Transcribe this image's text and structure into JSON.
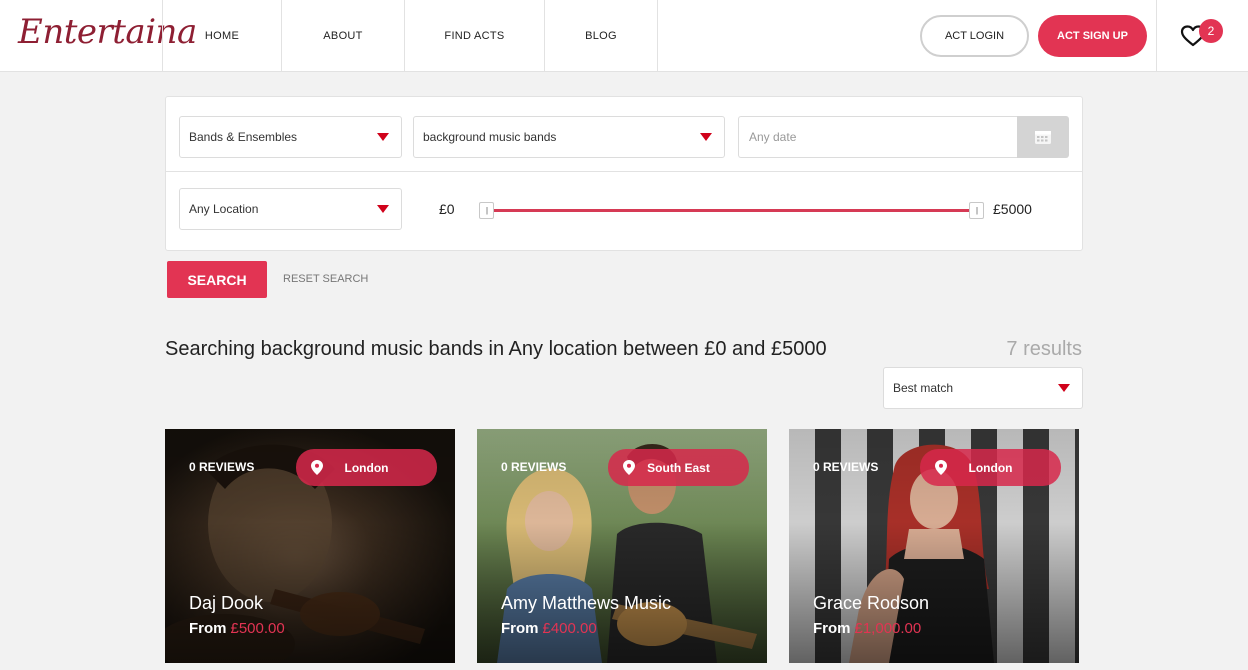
{
  "brand": {
    "logo": "Entertaina"
  },
  "nav": {
    "items": [
      "HOME",
      "ABOUT",
      "FIND ACTS",
      "BLOG"
    ],
    "act_login": "ACT LOGIN",
    "act_signup": "ACT SIGN UP",
    "favourites_count": "2"
  },
  "search": {
    "category": "Bands & Ensembles",
    "subcategory": "background music bands",
    "date_placeholder": "Any date",
    "location": "Any Location",
    "price_min": "£0",
    "price_max": "£5000",
    "search_button": "SEARCH",
    "reset_link": "RESET SEARCH"
  },
  "results": {
    "summary": "Searching background music bands in Any location between £0 and £5000",
    "count": "7 results",
    "sort": "Best match"
  },
  "cards": [
    {
      "reviews": "0 REVIEWS",
      "location": "London",
      "name": "Daj Dook",
      "from": "From",
      "price": "£500.00"
    },
    {
      "reviews": "0 REVIEWS",
      "location": "South East",
      "name": "Amy Matthews Music",
      "from": "From",
      "price": "£400.00"
    },
    {
      "reviews": "0 REVIEWS",
      "location": "London",
      "name": "Grace Rodson",
      "from": "From",
      "price": "£1,000.00"
    }
  ],
  "colors": {
    "accent": "#e23453",
    "logo": "#8e1f33",
    "caret": "#d0021b"
  }
}
